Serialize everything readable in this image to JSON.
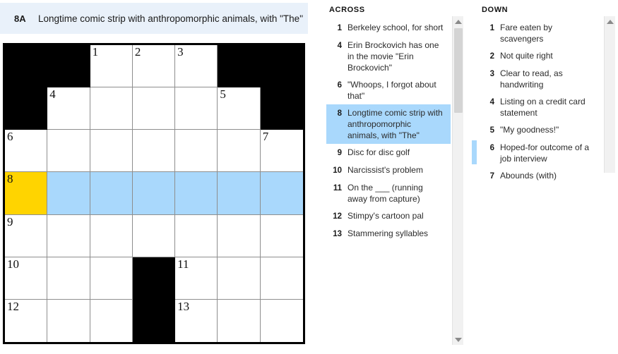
{
  "current_clue": {
    "number_label": "8A",
    "text": "Longtime comic strip with anthropomorphic animals, with \"The\""
  },
  "colors": {
    "highlight": "#a9d8fc",
    "cursor": "#ffd400",
    "banner_bg": "#e9f1fa",
    "block": "#000000"
  },
  "grid": {
    "rows": 7,
    "cols": 7,
    "cells": [
      [
        {
          "type": "block"
        },
        {
          "type": "block"
        },
        {
          "type": "open",
          "number": "1"
        },
        {
          "type": "open",
          "number": "2"
        },
        {
          "type": "open",
          "number": "3"
        },
        {
          "type": "block"
        },
        {
          "type": "block"
        }
      ],
      [
        {
          "type": "block"
        },
        {
          "type": "open",
          "number": "4"
        },
        {
          "type": "open"
        },
        {
          "type": "open"
        },
        {
          "type": "open"
        },
        {
          "type": "open",
          "number": "5"
        },
        {
          "type": "block"
        }
      ],
      [
        {
          "type": "open",
          "number": "6"
        },
        {
          "type": "open"
        },
        {
          "type": "open"
        },
        {
          "type": "open"
        },
        {
          "type": "open"
        },
        {
          "type": "open"
        },
        {
          "type": "open",
          "number": "7"
        }
      ],
      [
        {
          "type": "cursor",
          "number": "8"
        },
        {
          "type": "highlight"
        },
        {
          "type": "highlight"
        },
        {
          "type": "highlight"
        },
        {
          "type": "highlight"
        },
        {
          "type": "highlight"
        },
        {
          "type": "highlight"
        }
      ],
      [
        {
          "type": "open",
          "number": "9"
        },
        {
          "type": "open"
        },
        {
          "type": "open"
        },
        {
          "type": "open"
        },
        {
          "type": "open"
        },
        {
          "type": "open"
        },
        {
          "type": "open"
        }
      ],
      [
        {
          "type": "open",
          "number": "10"
        },
        {
          "type": "open"
        },
        {
          "type": "open"
        },
        {
          "type": "block"
        },
        {
          "type": "open",
          "number": "11"
        },
        {
          "type": "open"
        },
        {
          "type": "open"
        }
      ],
      [
        {
          "type": "open",
          "number": "12"
        },
        {
          "type": "open"
        },
        {
          "type": "open"
        },
        {
          "type": "block"
        },
        {
          "type": "open",
          "number": "13"
        },
        {
          "type": "open"
        },
        {
          "type": "open"
        }
      ]
    ]
  },
  "across": {
    "heading": "ACROSS",
    "clues": [
      {
        "num": "1",
        "text": "Berkeley school, for short",
        "state": "normal"
      },
      {
        "num": "4",
        "text": "Erin Brockovich has one in the movie \"Erin Brockovich\"",
        "state": "normal"
      },
      {
        "num": "6",
        "text": "\"Whoops, I forgot about that\"",
        "state": "normal"
      },
      {
        "num": "8",
        "text": "Longtime comic strip with anthropomorphic animals, with \"The\"",
        "state": "selected"
      },
      {
        "num": "9",
        "text": "Disc for disc golf",
        "state": "normal"
      },
      {
        "num": "10",
        "text": "Narcissist's problem",
        "state": "normal"
      },
      {
        "num": "11",
        "text": "On the ___ (running away from capture)",
        "state": "normal"
      },
      {
        "num": "12",
        "text": "Stimpy's cartoon pal",
        "state": "normal"
      },
      {
        "num": "13",
        "text": "Stammering syllables",
        "state": "normal"
      }
    ]
  },
  "down": {
    "heading": "DOWN",
    "clues": [
      {
        "num": "1",
        "text": "Fare eaten by scavengers",
        "state": "normal"
      },
      {
        "num": "2",
        "text": "Not quite right",
        "state": "normal"
      },
      {
        "num": "3",
        "text": "Clear to read, as handwriting",
        "state": "normal"
      },
      {
        "num": "4",
        "text": "Listing on a credit card statement",
        "state": "normal"
      },
      {
        "num": "5",
        "text": "\"My goodness!\"",
        "state": "normal"
      },
      {
        "num": "6",
        "text": "Hoped-for outcome of a job interview",
        "state": "cross"
      },
      {
        "num": "7",
        "text": "Abounds (with)",
        "state": "normal"
      }
    ]
  },
  "scrollbars": {
    "across": {
      "up_icon": "triangle-up-icon",
      "down_icon": "triangle-down-icon"
    },
    "down": {
      "up_icon": "triangle-up-icon"
    }
  }
}
